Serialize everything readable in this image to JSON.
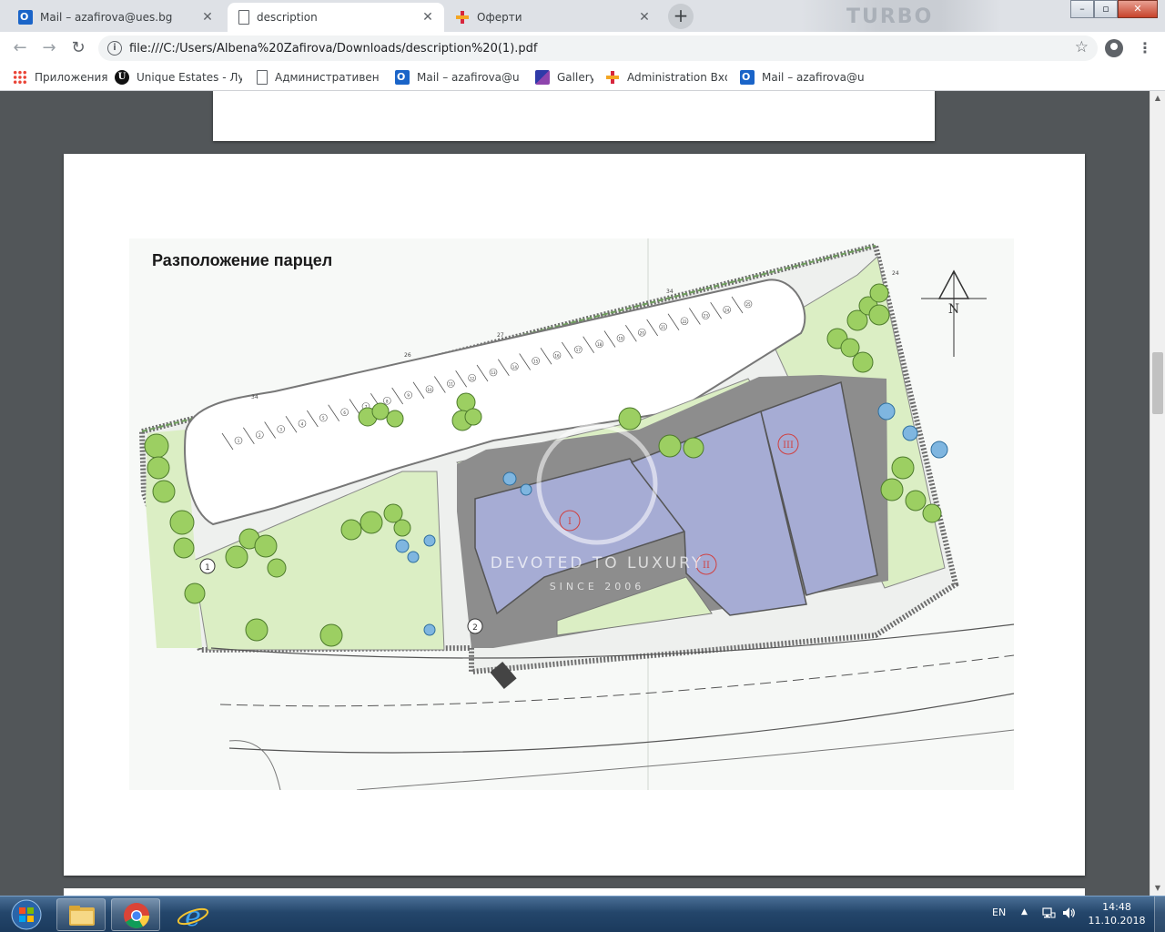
{
  "browser": {
    "tabs": [
      {
        "title": "Mail – azafirova@ues.bg",
        "icon": "outlook-icon",
        "active": false
      },
      {
        "title": "description",
        "icon": "document-icon",
        "active": true
      },
      {
        "title": "Оферти",
        "icon": "cross-logo-icon",
        "active": false
      }
    ],
    "new_tab_label": "+",
    "window_controls": {
      "minimize": "–",
      "maximize": "▫",
      "close": "✕"
    },
    "tab_strip_watermark": "TURBO"
  },
  "toolbar": {
    "back": "←",
    "forward": "→",
    "reload": "↻",
    "site_info": "i",
    "url": "file:///C:/Users/Albena%20Zafirova/Downloads/description%20(1).pdf",
    "bookmark_star": "☆",
    "menu": "⋮"
  },
  "bookmarks": [
    {
      "label": "Приложения",
      "icon": "apps-grid-icon"
    },
    {
      "label": "Unique Estates - Лук",
      "icon": "unique-logo-icon"
    },
    {
      "label": "Административен п",
      "icon": "document-icon"
    },
    {
      "label": "Mail – azafirova@ues",
      "icon": "outlook-icon"
    },
    {
      "label": "Gallery",
      "icon": "gallery-icon"
    },
    {
      "label": "Administration Вход",
      "icon": "cross-logo-icon"
    },
    {
      "label": "Mail – azafirova@ues",
      "icon": "outlook-icon"
    }
  ],
  "document": {
    "page_title": "Разположение парцел",
    "watermark_line1": "DEVOTED TO LUXURY",
    "watermark_line2": "SINCE 2006",
    "building_labels": [
      "I",
      "II",
      "III"
    ],
    "entrance_markers": [
      "1",
      "2"
    ],
    "compass_letter": "N",
    "parcel_numbers": [
      "34",
      "27",
      "26",
      "34",
      "24"
    ],
    "parking_numbers": [
      "1",
      "2",
      "3",
      "4",
      "5",
      "6",
      "7",
      "8",
      "9",
      "10",
      "11",
      "12",
      "13",
      "14",
      "15",
      "16",
      "17",
      "18",
      "19",
      "20",
      "21",
      "22",
      "23",
      "24",
      "25"
    ]
  },
  "scrollbar": {
    "up": "▲",
    "down": "▼",
    "position": 0.33
  },
  "taskbar": {
    "apps": [
      {
        "name": "explorer",
        "icon": "folder-icon"
      },
      {
        "name": "chrome",
        "icon": "chrome-icon"
      },
      {
        "name": "internet-explorer",
        "icon": "ie-icon"
      }
    ],
    "language": "EN",
    "tray_arrow": "▲",
    "time": "14:48",
    "date": "11.10.2018 г."
  },
  "colors": {
    "viewer_background": "#525659",
    "lawn": "#dbeec4",
    "tree": "#9ccf62",
    "building": "#a6acd4",
    "paving": "#8d8d8d",
    "taskbar": "#24466b"
  }
}
